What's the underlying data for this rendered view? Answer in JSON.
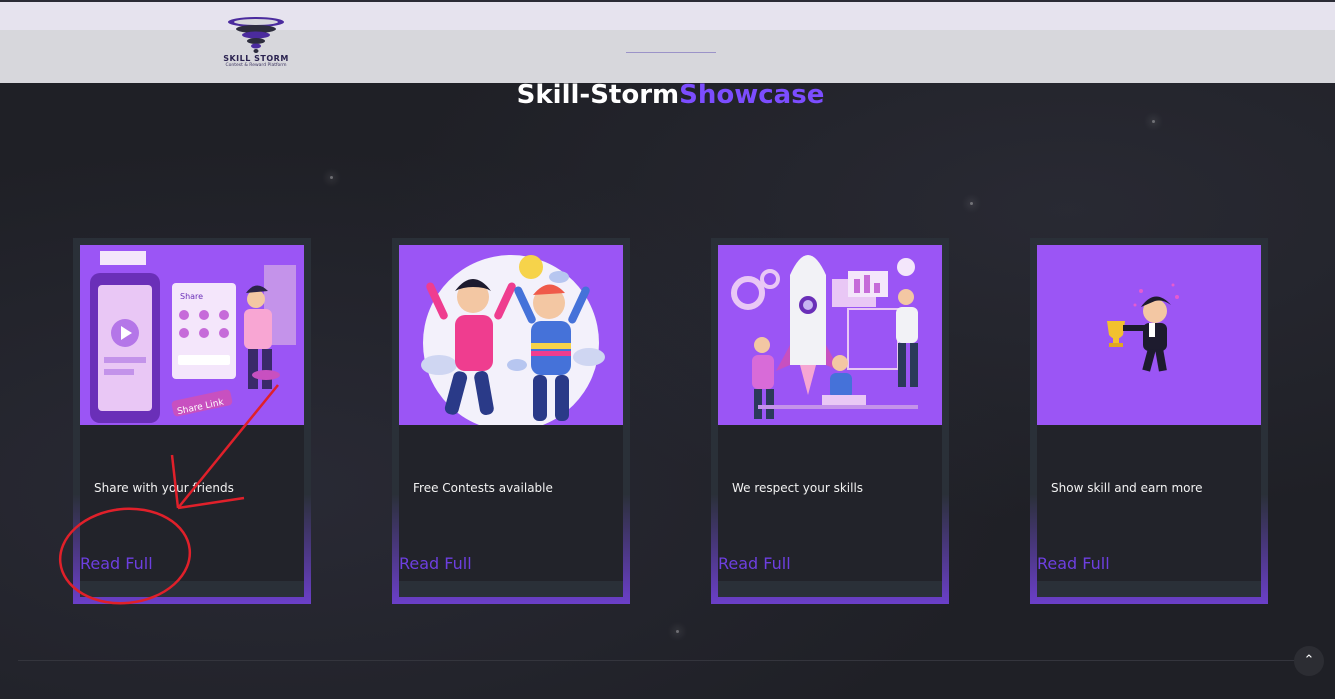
{
  "header": {
    "logo_title": "SKILL STORM",
    "logo_subtitle": "Contest & Reward Platform"
  },
  "section": {
    "title_main": "Skill-Storm",
    "title_accent": "Showcase"
  },
  "cards": [
    {
      "text": "Share with your friends",
      "link": "Read Full",
      "image": "share-link-illustration"
    },
    {
      "text": "Free Contests available",
      "link": "Read Full",
      "image": "celebrating-friends-illustration"
    },
    {
      "text": "We respect your skills",
      "link": "Read Full",
      "image": "rocket-team-illustration"
    },
    {
      "text": "Show skill and earn more",
      "link": "Read Full",
      "image": "trophy-winner-illustration"
    }
  ],
  "scroll_top": {
    "icon": "chevron-up-icon",
    "glyph": "⌃"
  },
  "colors": {
    "accent": "#7c4dff",
    "link": "#6d3fe0",
    "card_image_bg": "#9b55f5",
    "annotation": "#e0202a"
  }
}
